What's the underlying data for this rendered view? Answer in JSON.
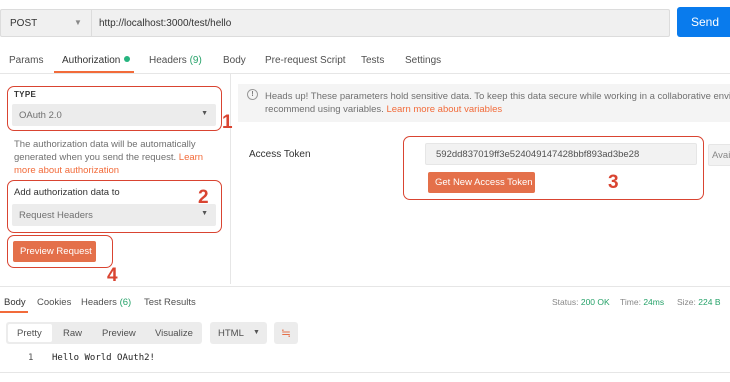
{
  "request": {
    "method": "POST",
    "url": "http://localhost:3000/test/hello",
    "send_label": "Send"
  },
  "tabs": [
    {
      "label": "Params"
    },
    {
      "label": "Authorization",
      "active": true
    },
    {
      "label": "Headers",
      "count": "(9)"
    },
    {
      "label": "Body"
    },
    {
      "label": "Pre-request Script"
    },
    {
      "label": "Tests"
    },
    {
      "label": "Settings"
    }
  ],
  "auth": {
    "type_label": "TYPE",
    "type_value": "OAuth 2.0",
    "help_text": "The authorization data will be automatically generated when you send the request.",
    "help_link": "Learn more about authorization",
    "add_to_label": "Add authorization data to",
    "add_to_value": "Request Headers",
    "preview_label": "Preview Request"
  },
  "banner": {
    "line1": "Heads up! These parameters hold sensitive data. To keep this data secure while working in a collaborative environ",
    "line2": "recommend using variables.",
    "link": "Learn more about variables"
  },
  "token": {
    "label": "Access Token",
    "value": "592dd837019ff3e524049147428bbf893ad3be28",
    "available_label": "Avail",
    "get_button": "Get New Access Token"
  },
  "annotations": [
    "1",
    "2",
    "3",
    "4"
  ],
  "response": {
    "tabs": [
      {
        "label": "Body",
        "active": true
      },
      {
        "label": "Cookies"
      },
      {
        "label": "Headers",
        "count": "(6)"
      },
      {
        "label": "Test Results"
      }
    ],
    "status_label": "Status:",
    "status_value": "200 OK",
    "time_label": "Time:",
    "time_value": "24ms",
    "size_label": "Size:",
    "size_value": "224 B",
    "view_modes": [
      "Pretty",
      "Raw",
      "Preview",
      "Visualize"
    ],
    "format": "HTML",
    "lines": [
      {
        "number": "1",
        "text": "Hello World OAuth2!"
      }
    ]
  },
  "colors": {
    "accent": "#f26b3a",
    "send": "#097bed",
    "annotation": "#d94431",
    "success": "#26a269"
  },
  "icons": [
    "chevron-down-icon",
    "info-icon",
    "wrap-lines-icon"
  ]
}
